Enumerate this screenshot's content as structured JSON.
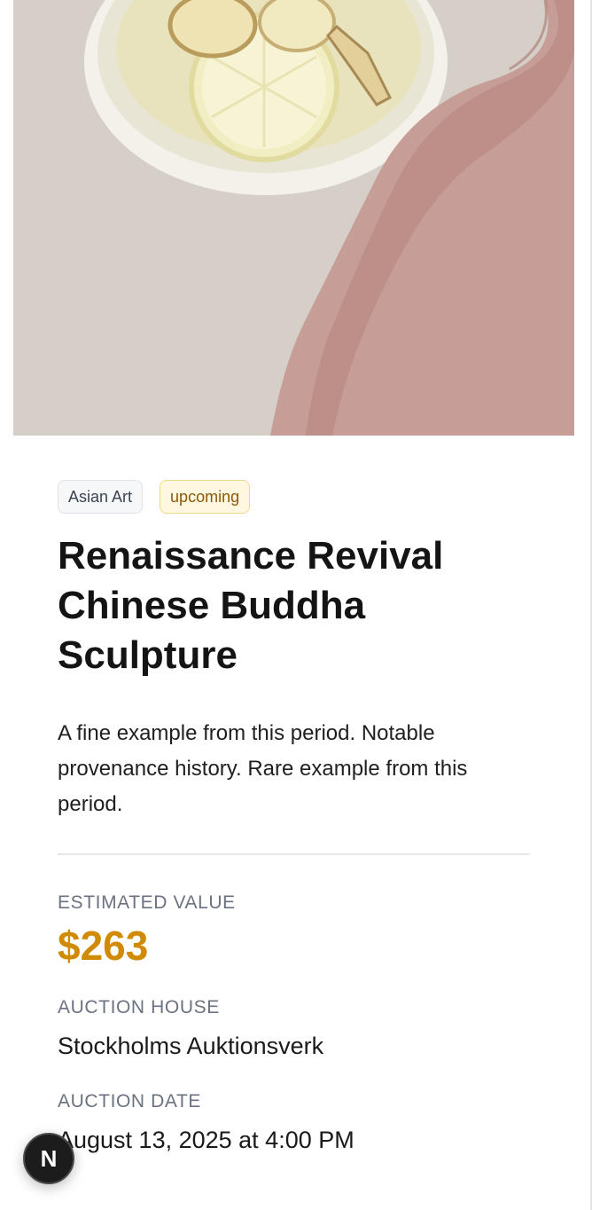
{
  "hero_image": {
    "alt": "Hand beside a bowl of lemon and ginger slices",
    "icon": "photo-lemon-ginger-bowl"
  },
  "tags": {
    "category": "Asian Art",
    "status": "upcoming"
  },
  "item": {
    "title": "Renaissance Revival Chinese Buddha Sculpture",
    "description": "A fine example from this period. Notable provenance history. Rare example from this period."
  },
  "details": {
    "estimated_value_label": "ESTIMATED VALUE",
    "estimated_value": "$263",
    "auction_house_label": "AUCTION HOUSE",
    "auction_house": "Stockholms Auktionsverk",
    "auction_date_label": "AUCTION DATE",
    "auction_date": "August 13, 2025 at 4:00 PM"
  },
  "dev_badge": {
    "letter": "N"
  },
  "colors": {
    "price": "#d18a06",
    "status_tag_bg": "#fff7e0",
    "status_tag_text": "#8a5a08",
    "label_gray": "#6b7280"
  }
}
